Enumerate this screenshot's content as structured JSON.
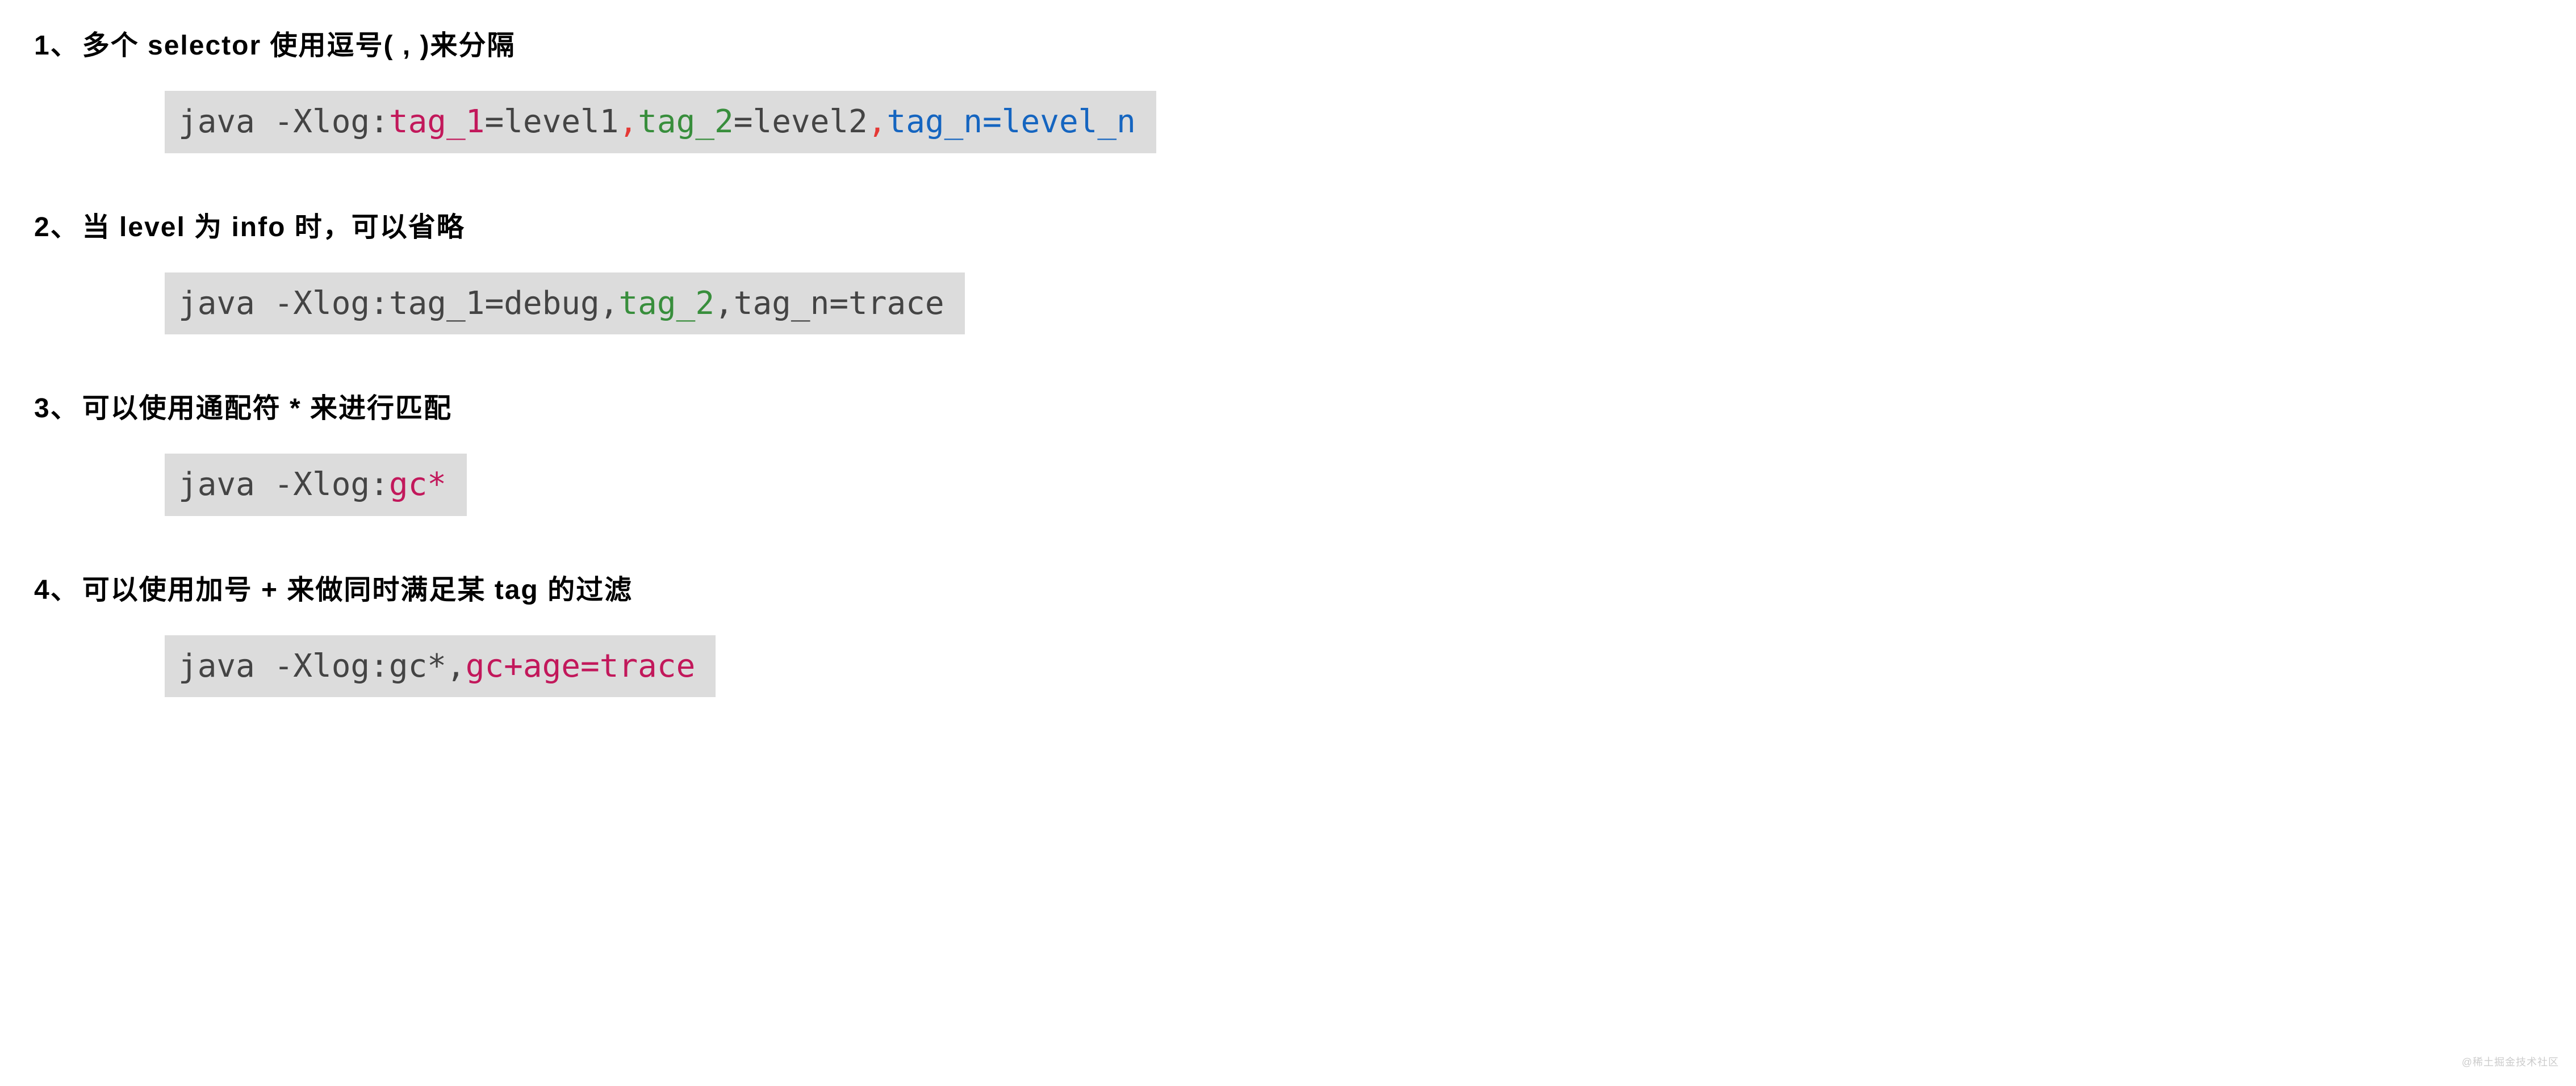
{
  "items": [
    {
      "num": "1、",
      "title": "多个 selector 使用逗号( , )来分隔",
      "code": [
        {
          "t": "java -Xlog:",
          "c": "c-default"
        },
        {
          "t": "tag_1",
          "c": "c-red"
        },
        {
          "t": "=level1",
          "c": "c-default"
        },
        {
          "t": ",",
          "c": "c-redor"
        },
        {
          "t": "tag_2",
          "c": "c-green"
        },
        {
          "t": "=level2",
          "c": "c-default"
        },
        {
          "t": ",",
          "c": "c-redor"
        },
        {
          "t": "tag_n",
          "c": "c-blue"
        },
        {
          "t": "=",
          "c": "c-blue"
        },
        {
          "t": "level_n",
          "c": "c-blue2"
        }
      ]
    },
    {
      "num": "2、",
      "title": "当 level 为 info 时，可以省略",
      "code": [
        {
          "t": "java -Xlog:tag_1=debug,",
          "c": "c-default"
        },
        {
          "t": "tag_2",
          "c": "c-green"
        },
        {
          "t": ",tag_n=trace",
          "c": "c-default"
        }
      ]
    },
    {
      "num": "3、",
      "title": "可以使用通配符 * 来进行匹配",
      "code": [
        {
          "t": "java -Xlog:",
          "c": "c-default"
        },
        {
          "t": "gc*",
          "c": "c-red"
        }
      ]
    },
    {
      "num": "4、",
      "title": "可以使用加号 + 来做同时满足某 tag 的过滤",
      "code": [
        {
          "t": "java -Xlog:gc*,",
          "c": "c-default"
        },
        {
          "t": "gc+age=trace",
          "c": "c-red"
        }
      ]
    }
  ],
  "watermark": "@稀土掘金技术社区"
}
